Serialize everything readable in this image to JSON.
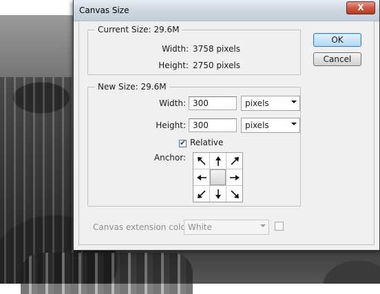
{
  "dialog": {
    "title": "Canvas Size",
    "close_glyph": "X",
    "current_size": {
      "legend": "Current Size: 29.6M",
      "width_label": "Width:",
      "width_value": "3758 pixels",
      "height_label": "Height:",
      "height_value": "2750 pixels"
    },
    "new_size": {
      "legend": "New Size: 29.6M",
      "width_label": "Width:",
      "width_value": "300",
      "width_unit": "pixels",
      "height_label": "Height:",
      "height_value": "300",
      "height_unit": "pixels",
      "relative_label": "Relative",
      "relative_checked": true,
      "anchor_label": "Anchor:"
    },
    "extension": {
      "label": "Canvas extension color:",
      "value": "White"
    },
    "buttons": {
      "ok": "OK",
      "cancel": "Cancel"
    }
  }
}
